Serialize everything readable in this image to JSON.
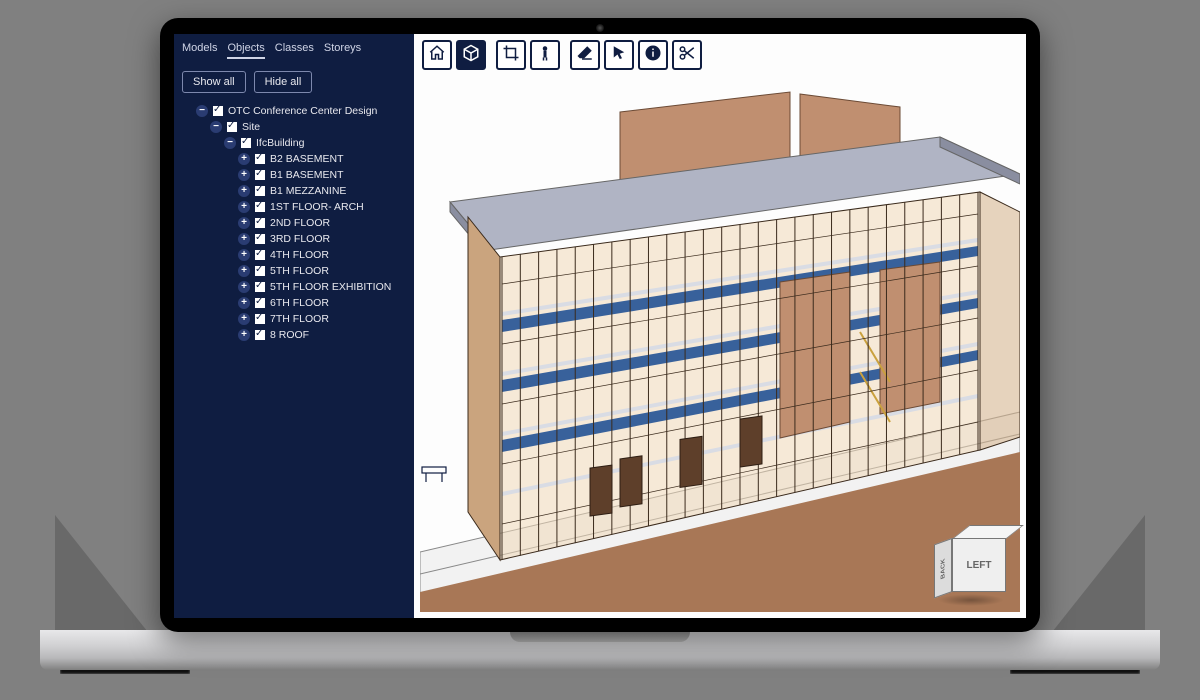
{
  "sidebar": {
    "tabs": [
      "Models",
      "Objects",
      "Classes",
      "Storeys"
    ],
    "active_tab_index": 1,
    "show_all_label": "Show all",
    "hide_all_label": "Hide all",
    "tree": {
      "root": {
        "label": "OTC Conference Center Design",
        "expanded": true
      },
      "site": {
        "label": "Site",
        "expanded": true
      },
      "building": {
        "label": "IfcBuilding",
        "expanded": true
      },
      "storeys": [
        {
          "label": "B2 BASEMENT"
        },
        {
          "label": "B1 BASEMENT"
        },
        {
          "label": "B1 MEZZANINE"
        },
        {
          "label": "1ST FLOOR- ARCH"
        },
        {
          "label": "2ND FLOOR"
        },
        {
          "label": "3RD FLOOR"
        },
        {
          "label": "4TH FLOOR"
        },
        {
          "label": "5TH FLOOR"
        },
        {
          "label": "5TH FLOOR EXHIBITION"
        },
        {
          "label": "6TH FLOOR"
        },
        {
          "label": "7TH FLOOR"
        },
        {
          "label": "8 ROOF"
        }
      ]
    }
  },
  "toolbar": {
    "groups": [
      [
        {
          "name": "home-icon",
          "active": false
        },
        {
          "name": "cube-icon",
          "active": true
        }
      ],
      [
        {
          "name": "crop-icon",
          "active": false
        },
        {
          "name": "person-icon",
          "active": false
        }
      ],
      [
        {
          "name": "eraser-icon",
          "active": false
        },
        {
          "name": "cursor-icon",
          "active": false
        },
        {
          "name": "info-icon",
          "active": false
        },
        {
          "name": "scissors-icon",
          "active": false
        }
      ]
    ]
  },
  "navcube": {
    "front_label": "LEFT",
    "side_label": "BACK"
  },
  "colors": {
    "panel": "#0f1d41",
    "wall": "#c08f70",
    "glass": "#f0d9b8",
    "roof": "#b0b4c4",
    "accent_blue": "#38619b",
    "ground": "#a87756"
  }
}
